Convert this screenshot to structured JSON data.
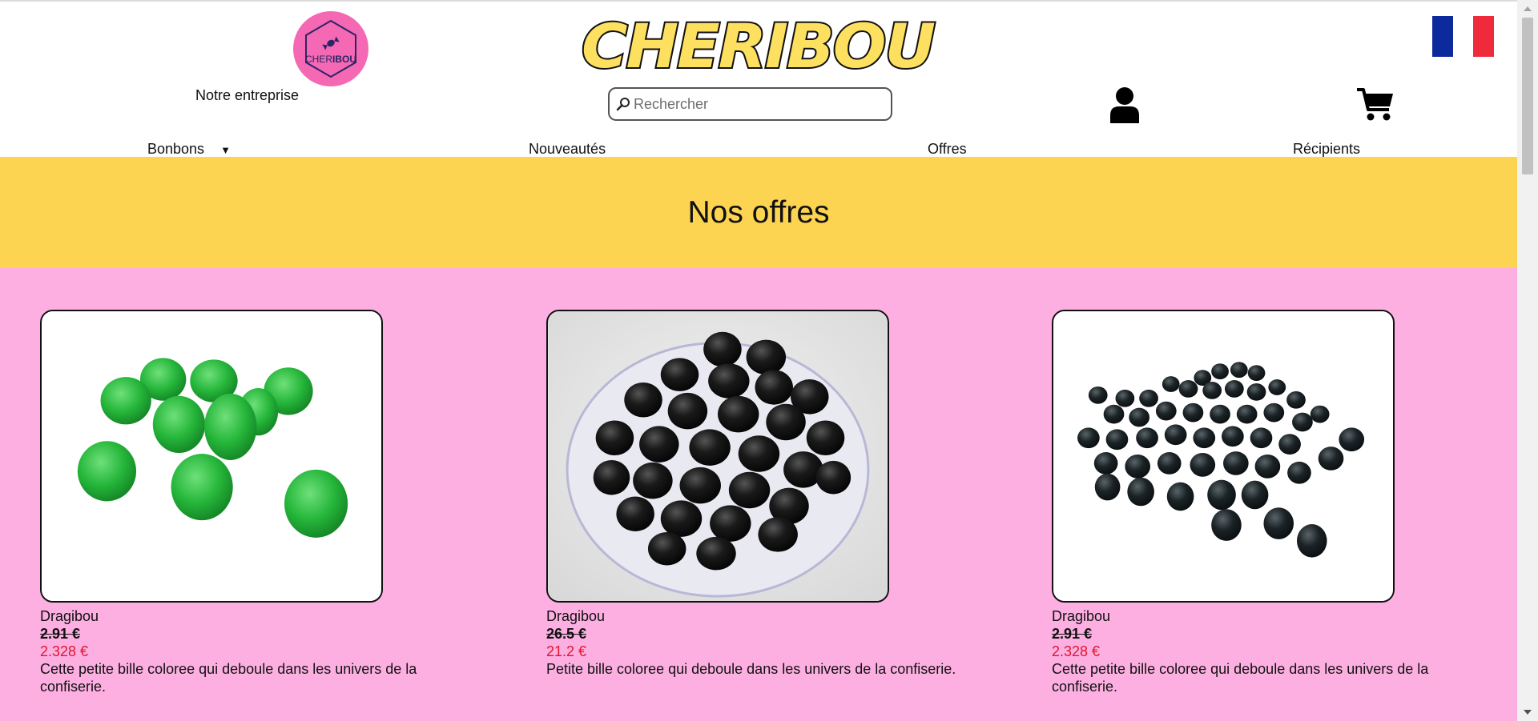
{
  "header": {
    "logo_text_left": "CHER",
    "logo_text_right": "IBOU",
    "brand_title": "CHERIBOU",
    "company_link": "Notre entreprise",
    "search_placeholder": "Rechercher",
    "language": "fr"
  },
  "nav": {
    "items": [
      {
        "label": "Bonbons",
        "has_dropdown": true
      },
      {
        "label": "Nouveautés"
      },
      {
        "label": "Offres"
      },
      {
        "label": "Récipients"
      }
    ]
  },
  "banner": {
    "title": "Nos offres"
  },
  "products": [
    {
      "name": "Dragibou",
      "old_price": "2.91 €",
      "new_price": "2.328 €",
      "description": "Cette petite bille coloree qui deboule dans les univers de la confiserie.",
      "image": "green-candy-beads"
    },
    {
      "name": "Dragibou",
      "old_price": "26.5 €",
      "new_price": "21.2 €",
      "description": "Petite bille coloree qui deboule dans les univers de la confiserie.",
      "image": "black-candy-bowl"
    },
    {
      "name": "Dragibou",
      "old_price": "2.91 €",
      "new_price": "2.328 €",
      "description": "Cette petite bille coloree qui deboule dans les univers de la confiserie.",
      "image": "black-candy-beads"
    }
  ],
  "colors": {
    "brand_yellow": "#fdd451",
    "brand_pink": "#fdafe2",
    "logo_pink": "#f468b4",
    "price_red": "#e0162b",
    "flag_blue": "#0d2a9c",
    "flag_red": "#ef2a3a"
  }
}
